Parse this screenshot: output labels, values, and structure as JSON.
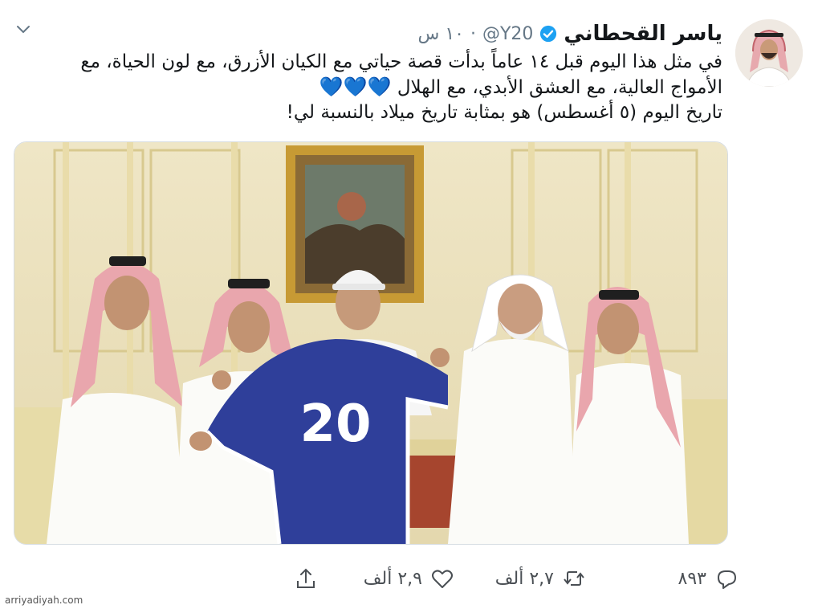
{
  "author": {
    "display_name": "ياسر القحطاني",
    "handle": "@Y20",
    "verified": true
  },
  "timestamp": "١٠ س",
  "separator": "·",
  "tweet": {
    "line1": "في مثل هذا اليوم قبل ١٤ عاماً بدأت قصة حياتي مع الكيان الأزرق، مع لون الحياة، مع",
    "line2": "الأمواج العالية، مع العشق الأبدي، مع الهلال",
    "hearts": "💙💙💙",
    "line3": "تاريخ اليوم (٥ أغسطس) هو بمثابة تاريخ ميلاد بالنسبة لي!"
  },
  "media": {
    "jersey_number": "20"
  },
  "actions": {
    "replies": "٨٩٣",
    "retweets": "٢,٧ ألف",
    "likes": "٢,٩ ألف"
  },
  "watermark": "arriyadiyah.com",
  "colors": {
    "accent": "#1da1f2",
    "heart_blue": "#3a9ee4",
    "jersey_blue": "#2f3f9a"
  },
  "icons": [
    "chevron-down-icon",
    "verified-icon",
    "reply-icon",
    "retweet-icon",
    "like-icon",
    "share-icon"
  ]
}
